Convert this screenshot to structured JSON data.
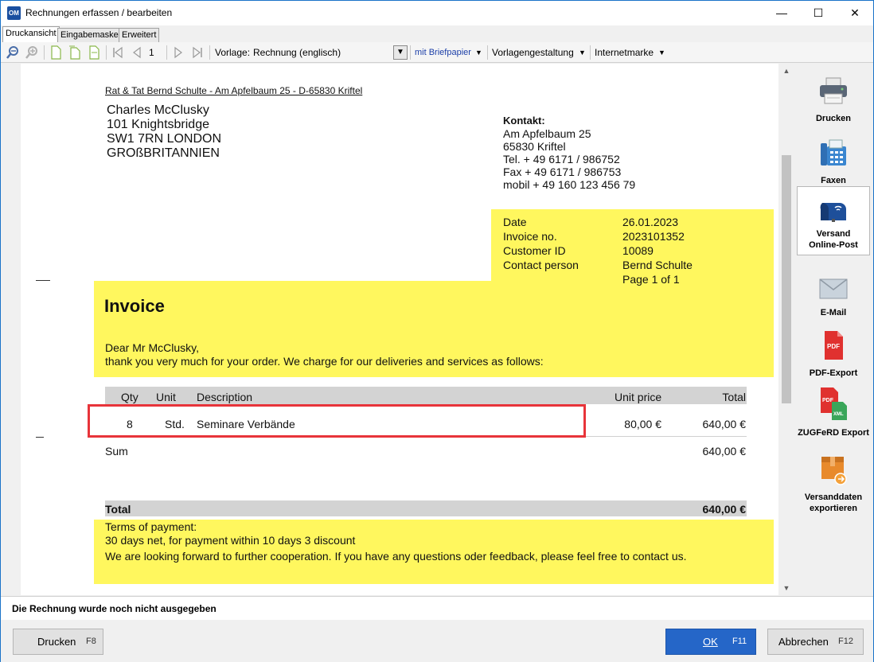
{
  "window": {
    "app_icon": "OM",
    "title": "Rechnungen erfassen / bearbeiten",
    "minimize_glyph": "—",
    "maximize_glyph": "☐",
    "close_glyph": "✕"
  },
  "tabs": [
    {
      "label": "Druckansicht",
      "active": true
    },
    {
      "label": "Eingabemaske",
      "active": false
    },
    {
      "label": "Erweitert",
      "active": false
    }
  ],
  "toolbar": {
    "page_number": "1",
    "vorlage_label": "Vorlage:",
    "vorlage_value": "Rechnung (englisch)",
    "briefpapier": "mit Briefpapier",
    "vorlagengestaltung": "Vorlagengestaltung",
    "internetmarke": "Internetmarke",
    "dropdown_glyph": "▼",
    "icons": [
      "zoom-out-icon",
      "zoom-in-icon",
      "page-icon",
      "pages-icon",
      "page-width-icon",
      "first-page-icon",
      "prev-page-icon",
      "next-page-icon",
      "last-page-icon"
    ]
  },
  "document": {
    "sender_line": "Rat & Tat Bernd Schulte - Am Apfelbaum 25 - D-65830 Kriftel",
    "recipient": [
      "Charles McClusky",
      "101 Knightsbridge",
      "SW1 7RN  LONDON",
      "GROßBRITANNIEN"
    ],
    "contact_title": "Kontakt:",
    "contact_lines": [
      "Am Apfelbaum 25",
      "65830 Kriftel",
      "Tel. + 49 6171 / 986752",
      "Fax + 49 6171 / 986753",
      "mobil + 49 160 123 456 79"
    ],
    "info": [
      {
        "label": "Date",
        "value": "26.01.2023"
      },
      {
        "label": "Invoice no.",
        "value": "2023101352"
      },
      {
        "label": "Customer ID",
        "value": "10089"
      },
      {
        "label": "Contact person",
        "value": "Bernd Schulte"
      }
    ],
    "page_info": "Page 1 of 1",
    "heading": "Invoice",
    "greeting": "Dear Mr  McClusky,",
    "intro": "thank you very much for your order. We charge for our deliveries and services as follows:",
    "table_headers": {
      "qty": "Qty",
      "unit": "Unit",
      "description": "Description",
      "unit_price": "Unit price",
      "total": "Total"
    },
    "items": [
      {
        "qty": "8",
        "unit": "Std.",
        "description": "Seminare Verbände",
        "unit_price": "80,00 €",
        "total": "640,00 €"
      }
    ],
    "sum_label": "Sum",
    "sum_value": "640,00 €",
    "total_label": "Total",
    "total_value": "640,00 €",
    "terms_title": "Terms of payment:",
    "terms_text": "30 days net, for payment within 10 days 3 discount",
    "closing": "We are looking forward to further cooperation. If you have any questions oder feedback, please feel free to contact us."
  },
  "sidebar": [
    {
      "label": "Drucken",
      "icon": "printer-icon"
    },
    {
      "label": "Faxen",
      "icon": "fax-icon"
    },
    {
      "label": "Versand\nOnline-Post",
      "label1": "Versand",
      "label2": "Online-Post",
      "icon": "mailbox-icon"
    },
    {
      "label": "E-Mail",
      "icon": "email-icon"
    },
    {
      "label": "PDF-Export",
      "icon": "pdf-icon"
    },
    {
      "label": "ZUGFeRD Export",
      "icon": "zugferd-icon"
    },
    {
      "label": "Versanddaten\nexportieren",
      "label1": "Versanddaten",
      "label2": "exportieren",
      "icon": "shipping-box-icon"
    }
  ],
  "status": "Die Rechnung wurde noch nicht ausgegeben",
  "buttons": {
    "print": {
      "label": "Drucken",
      "key": "F8"
    },
    "ok": {
      "label": "OK",
      "key": "F11"
    },
    "cancel": {
      "label": "Abbrechen",
      "key": "F12"
    }
  },
  "colors": {
    "highlight_yellow": "#fff75e",
    "selection_red": "#e8343a",
    "primary_blue": "#2566c8"
  }
}
